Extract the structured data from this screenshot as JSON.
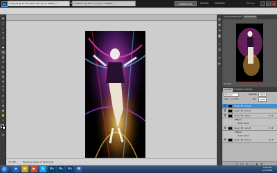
{
  "app": {
    "logo": "Ps",
    "menus": [
      "File",
      "Edit",
      "Image",
      "Layer",
      "Select",
      "Filter",
      "Analysis",
      "3D",
      "View",
      "Window",
      "Help"
    ],
    "zoom": "33.3",
    "workspaces": {
      "active": "ESSENTIALS",
      "design": "DESIGN",
      "painting": "PAINTING"
    },
    "cs_live": "CS Live",
    "window_buttons": [
      "_",
      "□",
      "×"
    ]
  },
  "options": {
    "size": "35",
    "mode_label": "Mode:",
    "mode_value": "Brush",
    "opacity_label": "Opacity:",
    "opacity_value": "100%",
    "flow_label": "Flow:",
    "flow_value": "100%"
  },
  "documents": {
    "tabs": [
      {
        "label": "wall.psd @ 33.3% (Layer 36 copy 9, RGB/8) *",
        "close": "×"
      },
      {
        "label": "Untitled-1 @ 66.7% (Layer 1, RGB/8) *",
        "close": "×"
      }
    ]
  },
  "status": {
    "zoom": "33.33%",
    "doc": "Exposure works in 32-bit only"
  },
  "panels": {
    "navigator_tabs": [
      "HISTOGRAM",
      "INFO",
      "NAVIGATOR"
    ],
    "nav_zoom": "33.33%",
    "layers_tabs": [
      "LAYERS",
      "CHANNELS",
      "PATHS"
    ],
    "blend_mode": "Normal",
    "opacity_label": "Opacity:",
    "opacity": "100%",
    "lock_label": "Lock:",
    "fill_label": "Fill:",
    "fill": "100%",
    "layers": [
      {
        "name": "Layer 36 copy 9",
        "fx": "",
        "selected": true
      },
      {
        "name": "Layer 36 copy 8",
        "fx": "",
        "selected": false
      },
      {
        "name": "Layer 36 copy 7",
        "fx": "fx ▾",
        "selected": false
      },
      {
        "name": "Layer 36 copy 6",
        "fx": "fx ▾",
        "selected": false
      },
      {
        "name": "Layer 36 copy 5",
        "fx": "fx ▾",
        "selected": false
      }
    ],
    "effects": [
      "Effects",
      "Outer Glow",
      "Effects",
      "Outer Glow"
    ],
    "footer": "⊖ fx ◐ ▢ ▣ ✖"
  },
  "taskbar": {
    "apps": [
      "e",
      "📁",
      "▶",
      "S",
      "Ps",
      "Ps",
      "Ps",
      "W"
    ],
    "time": "6:08 AM",
    "date": "1/31/2014"
  },
  "colors": {
    "selected_layer": "#3d8fd6",
    "nav_frame": "#d21e1e"
  }
}
